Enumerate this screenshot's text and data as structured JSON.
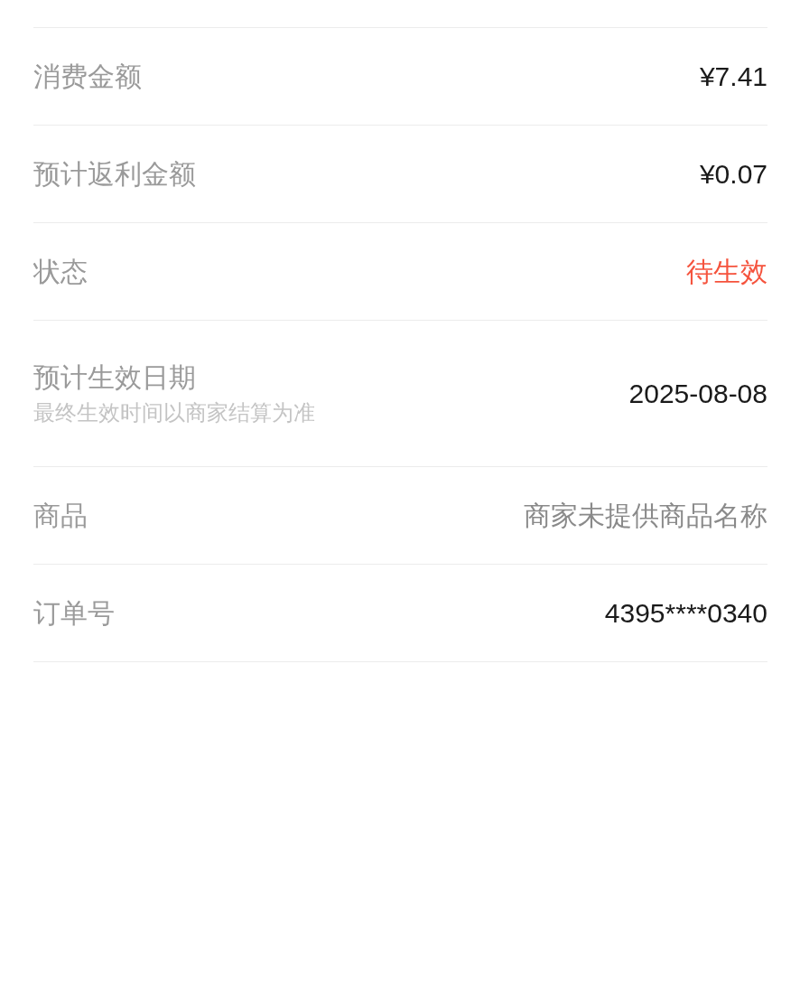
{
  "rows": [
    {
      "label": "消费金额",
      "value": "¥7.41",
      "highlight": false
    },
    {
      "label": "预计返利金额",
      "value": "¥0.07",
      "highlight": false
    },
    {
      "label": "状态",
      "value": "待生效",
      "highlight": true
    },
    {
      "label": "预计生效日期",
      "note": "最终生效时间以商家结算为准",
      "value": "2025-08-08",
      "highlight": false
    },
    {
      "label": "商品",
      "value": "商家未提供商品名称",
      "highlight": false,
      "muted": true
    },
    {
      "label": "订单号",
      "value": "4395****0340",
      "highlight": false
    }
  ]
}
